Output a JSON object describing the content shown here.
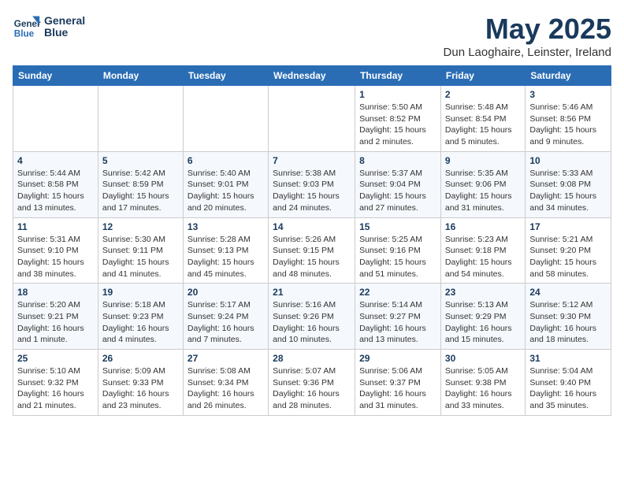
{
  "header": {
    "logo_line1": "General",
    "logo_line2": "Blue",
    "month": "May 2025",
    "location": "Dun Laoghaire, Leinster, Ireland"
  },
  "days_of_week": [
    "Sunday",
    "Monday",
    "Tuesday",
    "Wednesday",
    "Thursday",
    "Friday",
    "Saturday"
  ],
  "weeks": [
    [
      {
        "num": "",
        "info": ""
      },
      {
        "num": "",
        "info": ""
      },
      {
        "num": "",
        "info": ""
      },
      {
        "num": "",
        "info": ""
      },
      {
        "num": "1",
        "info": "Sunrise: 5:50 AM\nSunset: 8:52 PM\nDaylight: 15 hours\nand 2 minutes."
      },
      {
        "num": "2",
        "info": "Sunrise: 5:48 AM\nSunset: 8:54 PM\nDaylight: 15 hours\nand 5 minutes."
      },
      {
        "num": "3",
        "info": "Sunrise: 5:46 AM\nSunset: 8:56 PM\nDaylight: 15 hours\nand 9 minutes."
      }
    ],
    [
      {
        "num": "4",
        "info": "Sunrise: 5:44 AM\nSunset: 8:58 PM\nDaylight: 15 hours\nand 13 minutes."
      },
      {
        "num": "5",
        "info": "Sunrise: 5:42 AM\nSunset: 8:59 PM\nDaylight: 15 hours\nand 17 minutes."
      },
      {
        "num": "6",
        "info": "Sunrise: 5:40 AM\nSunset: 9:01 PM\nDaylight: 15 hours\nand 20 minutes."
      },
      {
        "num": "7",
        "info": "Sunrise: 5:38 AM\nSunset: 9:03 PM\nDaylight: 15 hours\nand 24 minutes."
      },
      {
        "num": "8",
        "info": "Sunrise: 5:37 AM\nSunset: 9:04 PM\nDaylight: 15 hours\nand 27 minutes."
      },
      {
        "num": "9",
        "info": "Sunrise: 5:35 AM\nSunset: 9:06 PM\nDaylight: 15 hours\nand 31 minutes."
      },
      {
        "num": "10",
        "info": "Sunrise: 5:33 AM\nSunset: 9:08 PM\nDaylight: 15 hours\nand 34 minutes."
      }
    ],
    [
      {
        "num": "11",
        "info": "Sunrise: 5:31 AM\nSunset: 9:10 PM\nDaylight: 15 hours\nand 38 minutes."
      },
      {
        "num": "12",
        "info": "Sunrise: 5:30 AM\nSunset: 9:11 PM\nDaylight: 15 hours\nand 41 minutes."
      },
      {
        "num": "13",
        "info": "Sunrise: 5:28 AM\nSunset: 9:13 PM\nDaylight: 15 hours\nand 45 minutes."
      },
      {
        "num": "14",
        "info": "Sunrise: 5:26 AM\nSunset: 9:15 PM\nDaylight: 15 hours\nand 48 minutes."
      },
      {
        "num": "15",
        "info": "Sunrise: 5:25 AM\nSunset: 9:16 PM\nDaylight: 15 hours\nand 51 minutes."
      },
      {
        "num": "16",
        "info": "Sunrise: 5:23 AM\nSunset: 9:18 PM\nDaylight: 15 hours\nand 54 minutes."
      },
      {
        "num": "17",
        "info": "Sunrise: 5:21 AM\nSunset: 9:20 PM\nDaylight: 15 hours\nand 58 minutes."
      }
    ],
    [
      {
        "num": "18",
        "info": "Sunrise: 5:20 AM\nSunset: 9:21 PM\nDaylight: 16 hours\nand 1 minute."
      },
      {
        "num": "19",
        "info": "Sunrise: 5:18 AM\nSunset: 9:23 PM\nDaylight: 16 hours\nand 4 minutes."
      },
      {
        "num": "20",
        "info": "Sunrise: 5:17 AM\nSunset: 9:24 PM\nDaylight: 16 hours\nand 7 minutes."
      },
      {
        "num": "21",
        "info": "Sunrise: 5:16 AM\nSunset: 9:26 PM\nDaylight: 16 hours\nand 10 minutes."
      },
      {
        "num": "22",
        "info": "Sunrise: 5:14 AM\nSunset: 9:27 PM\nDaylight: 16 hours\nand 13 minutes."
      },
      {
        "num": "23",
        "info": "Sunrise: 5:13 AM\nSunset: 9:29 PM\nDaylight: 16 hours\nand 15 minutes."
      },
      {
        "num": "24",
        "info": "Sunrise: 5:12 AM\nSunset: 9:30 PM\nDaylight: 16 hours\nand 18 minutes."
      }
    ],
    [
      {
        "num": "25",
        "info": "Sunrise: 5:10 AM\nSunset: 9:32 PM\nDaylight: 16 hours\nand 21 minutes."
      },
      {
        "num": "26",
        "info": "Sunrise: 5:09 AM\nSunset: 9:33 PM\nDaylight: 16 hours\nand 23 minutes."
      },
      {
        "num": "27",
        "info": "Sunrise: 5:08 AM\nSunset: 9:34 PM\nDaylight: 16 hours\nand 26 minutes."
      },
      {
        "num": "28",
        "info": "Sunrise: 5:07 AM\nSunset: 9:36 PM\nDaylight: 16 hours\nand 28 minutes."
      },
      {
        "num": "29",
        "info": "Sunrise: 5:06 AM\nSunset: 9:37 PM\nDaylight: 16 hours\nand 31 minutes."
      },
      {
        "num": "30",
        "info": "Sunrise: 5:05 AM\nSunset: 9:38 PM\nDaylight: 16 hours\nand 33 minutes."
      },
      {
        "num": "31",
        "info": "Sunrise: 5:04 AM\nSunset: 9:40 PM\nDaylight: 16 hours\nand 35 minutes."
      }
    ]
  ]
}
